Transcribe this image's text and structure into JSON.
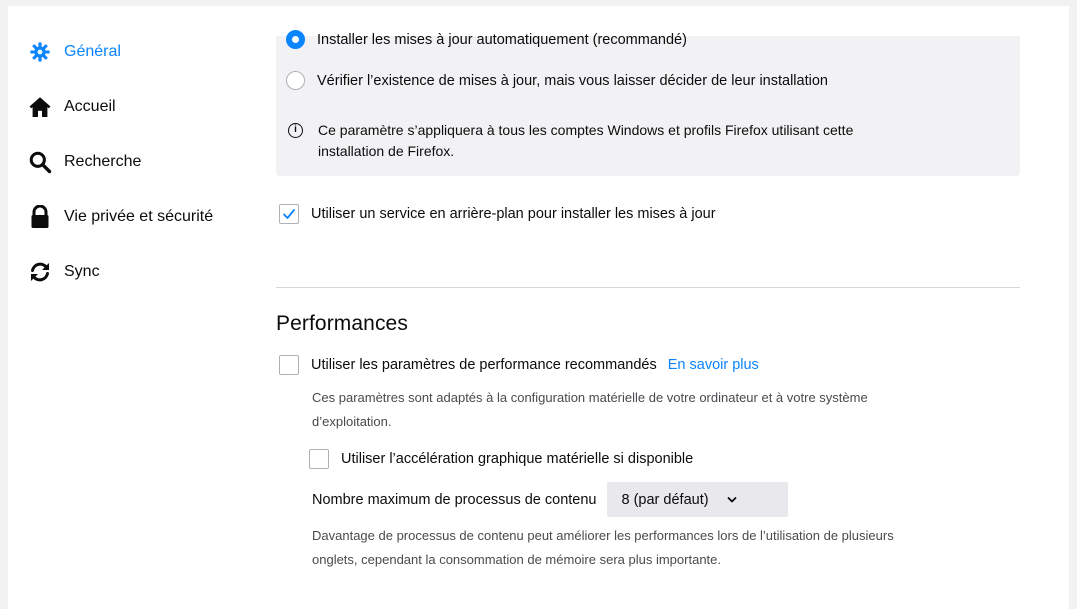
{
  "sidebar": {
    "items": [
      {
        "label": "Général",
        "icon": "gear-icon",
        "selected": true
      },
      {
        "label": "Accueil",
        "icon": "home-icon",
        "selected": false
      },
      {
        "label": "Recherche",
        "icon": "search-icon",
        "selected": false
      },
      {
        "label": "Vie privée et sécurité",
        "icon": "lock-icon",
        "selected": false
      },
      {
        "label": "Sync",
        "icon": "sync-icon",
        "selected": false
      }
    ]
  },
  "updates": {
    "auto_install_label": "Installer les mises à jour automatiquement (recommandé)",
    "auto_install_selected": true,
    "check_only_label": "Vérifier l’existence de mises à jour, mais vous laisser décider de leur installation",
    "check_only_selected": false,
    "info_line1": "Ce paramètre s’appliquera à tous les comptes Windows et profils Firefox utilisant cette",
    "info_line2": "installation de Firefox.",
    "background_service_label": "Utiliser un service en arrière-plan pour installer les mises à jour",
    "background_service_checked": true
  },
  "performance": {
    "title": "Performances",
    "recommended_label": "Utiliser les paramètres de performance recommandés",
    "recommended_checked": false,
    "learn_more": "En savoir plus",
    "recommended_desc_line1": "Ces paramètres sont adaptés à la configuration matérielle de votre ordinateur et à votre système",
    "recommended_desc_line2": "d’exploitation.",
    "hw_accel_label": "Utiliser l’accélération graphique matérielle si disponible",
    "hw_accel_checked": false,
    "content_process_label": "Nombre maximum de processus de contenu",
    "content_process_value": "8 (par défaut)",
    "content_process_desc_line1": "Davantage de processus de contenu peut améliorer les performances lors de l’utilisation de plusieurs",
    "content_process_desc_line2": "onglets, cependant la consommation de mémoire sera plus importante."
  },
  "colors": {
    "accent": "#0a84ff",
    "panel_bg": "#f2f2f4",
    "text": "#0c0c0d",
    "secondary_text": "#4a4a4f"
  }
}
